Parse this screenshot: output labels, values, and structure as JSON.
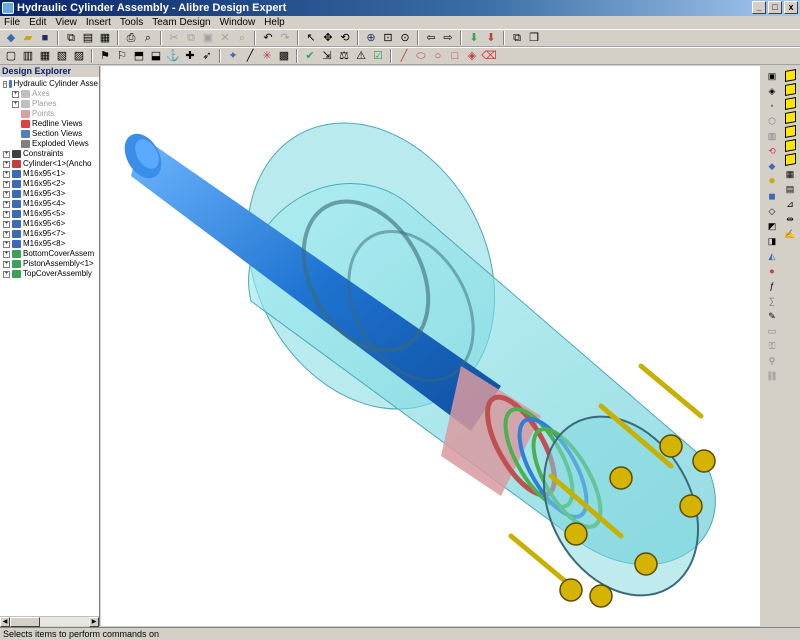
{
  "window": {
    "title": "Hydraulic Cylinder Assembly - Alibre Design Expert",
    "minimize": "_",
    "maximize": "□",
    "close": "x"
  },
  "menu": [
    "File",
    "Edit",
    "View",
    "Insert",
    "Tools",
    "Team Design",
    "Window",
    "Help"
  ],
  "explorer": {
    "title": "Design Explorer",
    "tree": [
      {
        "label": "Hydraulic Cylinder Asse",
        "indent": 0,
        "expander": "-",
        "icon": "assembly-icon",
        "color": "#4a78c8",
        "dimmed": false
      },
      {
        "label": "Axes",
        "indent": 1,
        "expander": "+",
        "icon": "axes-icon",
        "color": "#c0c0c0",
        "dimmed": true
      },
      {
        "label": "Planes",
        "indent": 1,
        "expander": "+",
        "icon": "planes-icon",
        "color": "#c0c0c0",
        "dimmed": true
      },
      {
        "label": "Points",
        "indent": 1,
        "expander": "",
        "icon": "points-icon",
        "color": "#d8a0a0",
        "dimmed": true
      },
      {
        "label": "Redline Views",
        "indent": 1,
        "expander": "",
        "icon": "redline-icon",
        "color": "#e04040",
        "dimmed": false
      },
      {
        "label": "Section Views",
        "indent": 1,
        "expander": "",
        "icon": "section-icon",
        "color": "#5080c0",
        "dimmed": false
      },
      {
        "label": "Exploded Views",
        "indent": 1,
        "expander": "",
        "icon": "exploded-icon",
        "color": "#808080",
        "dimmed": false
      },
      {
        "label": "Constraints",
        "indent": 0,
        "expander": "+",
        "icon": "constraints-icon",
        "color": "#404040",
        "dimmed": false
      },
      {
        "label": "Cylinder<1>(Ancho",
        "indent": 0,
        "expander": "+",
        "icon": "part-icon",
        "color": "#c04040",
        "dimmed": false
      },
      {
        "label": "M16x95<1>",
        "indent": 0,
        "expander": "+",
        "icon": "part-icon",
        "color": "#3a6ab8",
        "dimmed": false
      },
      {
        "label": "M16x95<2>",
        "indent": 0,
        "expander": "+",
        "icon": "part-icon",
        "color": "#3a6ab8",
        "dimmed": false
      },
      {
        "label": "M16x95<3>",
        "indent": 0,
        "expander": "+",
        "icon": "part-icon",
        "color": "#3a6ab8",
        "dimmed": false
      },
      {
        "label": "M16x95<4>",
        "indent": 0,
        "expander": "+",
        "icon": "part-icon",
        "color": "#3a6ab8",
        "dimmed": false
      },
      {
        "label": "M16x95<5>",
        "indent": 0,
        "expander": "+",
        "icon": "part-icon",
        "color": "#3a6ab8",
        "dimmed": false
      },
      {
        "label": "M16x95<6>",
        "indent": 0,
        "expander": "+",
        "icon": "part-icon",
        "color": "#3a6ab8",
        "dimmed": false
      },
      {
        "label": "M16x95<7>",
        "indent": 0,
        "expander": "+",
        "icon": "part-icon",
        "color": "#3a6ab8",
        "dimmed": false
      },
      {
        "label": "M16x95<8>",
        "indent": 0,
        "expander": "+",
        "icon": "part-icon",
        "color": "#3a6ab8",
        "dimmed": false
      },
      {
        "label": "BottomCoverAssem",
        "indent": 0,
        "expander": "+",
        "icon": "subassembly-icon",
        "color": "#3aa05a",
        "dimmed": false
      },
      {
        "label": "PistonAssembly<1>",
        "indent": 0,
        "expander": "+",
        "icon": "subassembly-icon",
        "color": "#3aa05a",
        "dimmed": false
      },
      {
        "label": "TopCoverAssembly",
        "indent": 0,
        "expander": "+",
        "icon": "subassembly-icon",
        "color": "#3aa05a",
        "dimmed": false
      }
    ]
  },
  "status": "Selects items to perform commands on",
  "colors": {
    "titlebar": "#0a246a",
    "face": "#d4d0c8",
    "rod": "#2f7fd8",
    "glass": "#7fd8e0",
    "seal_red": "#c05050",
    "seal_green": "#4cb050",
    "bolt": "#c8a800"
  }
}
